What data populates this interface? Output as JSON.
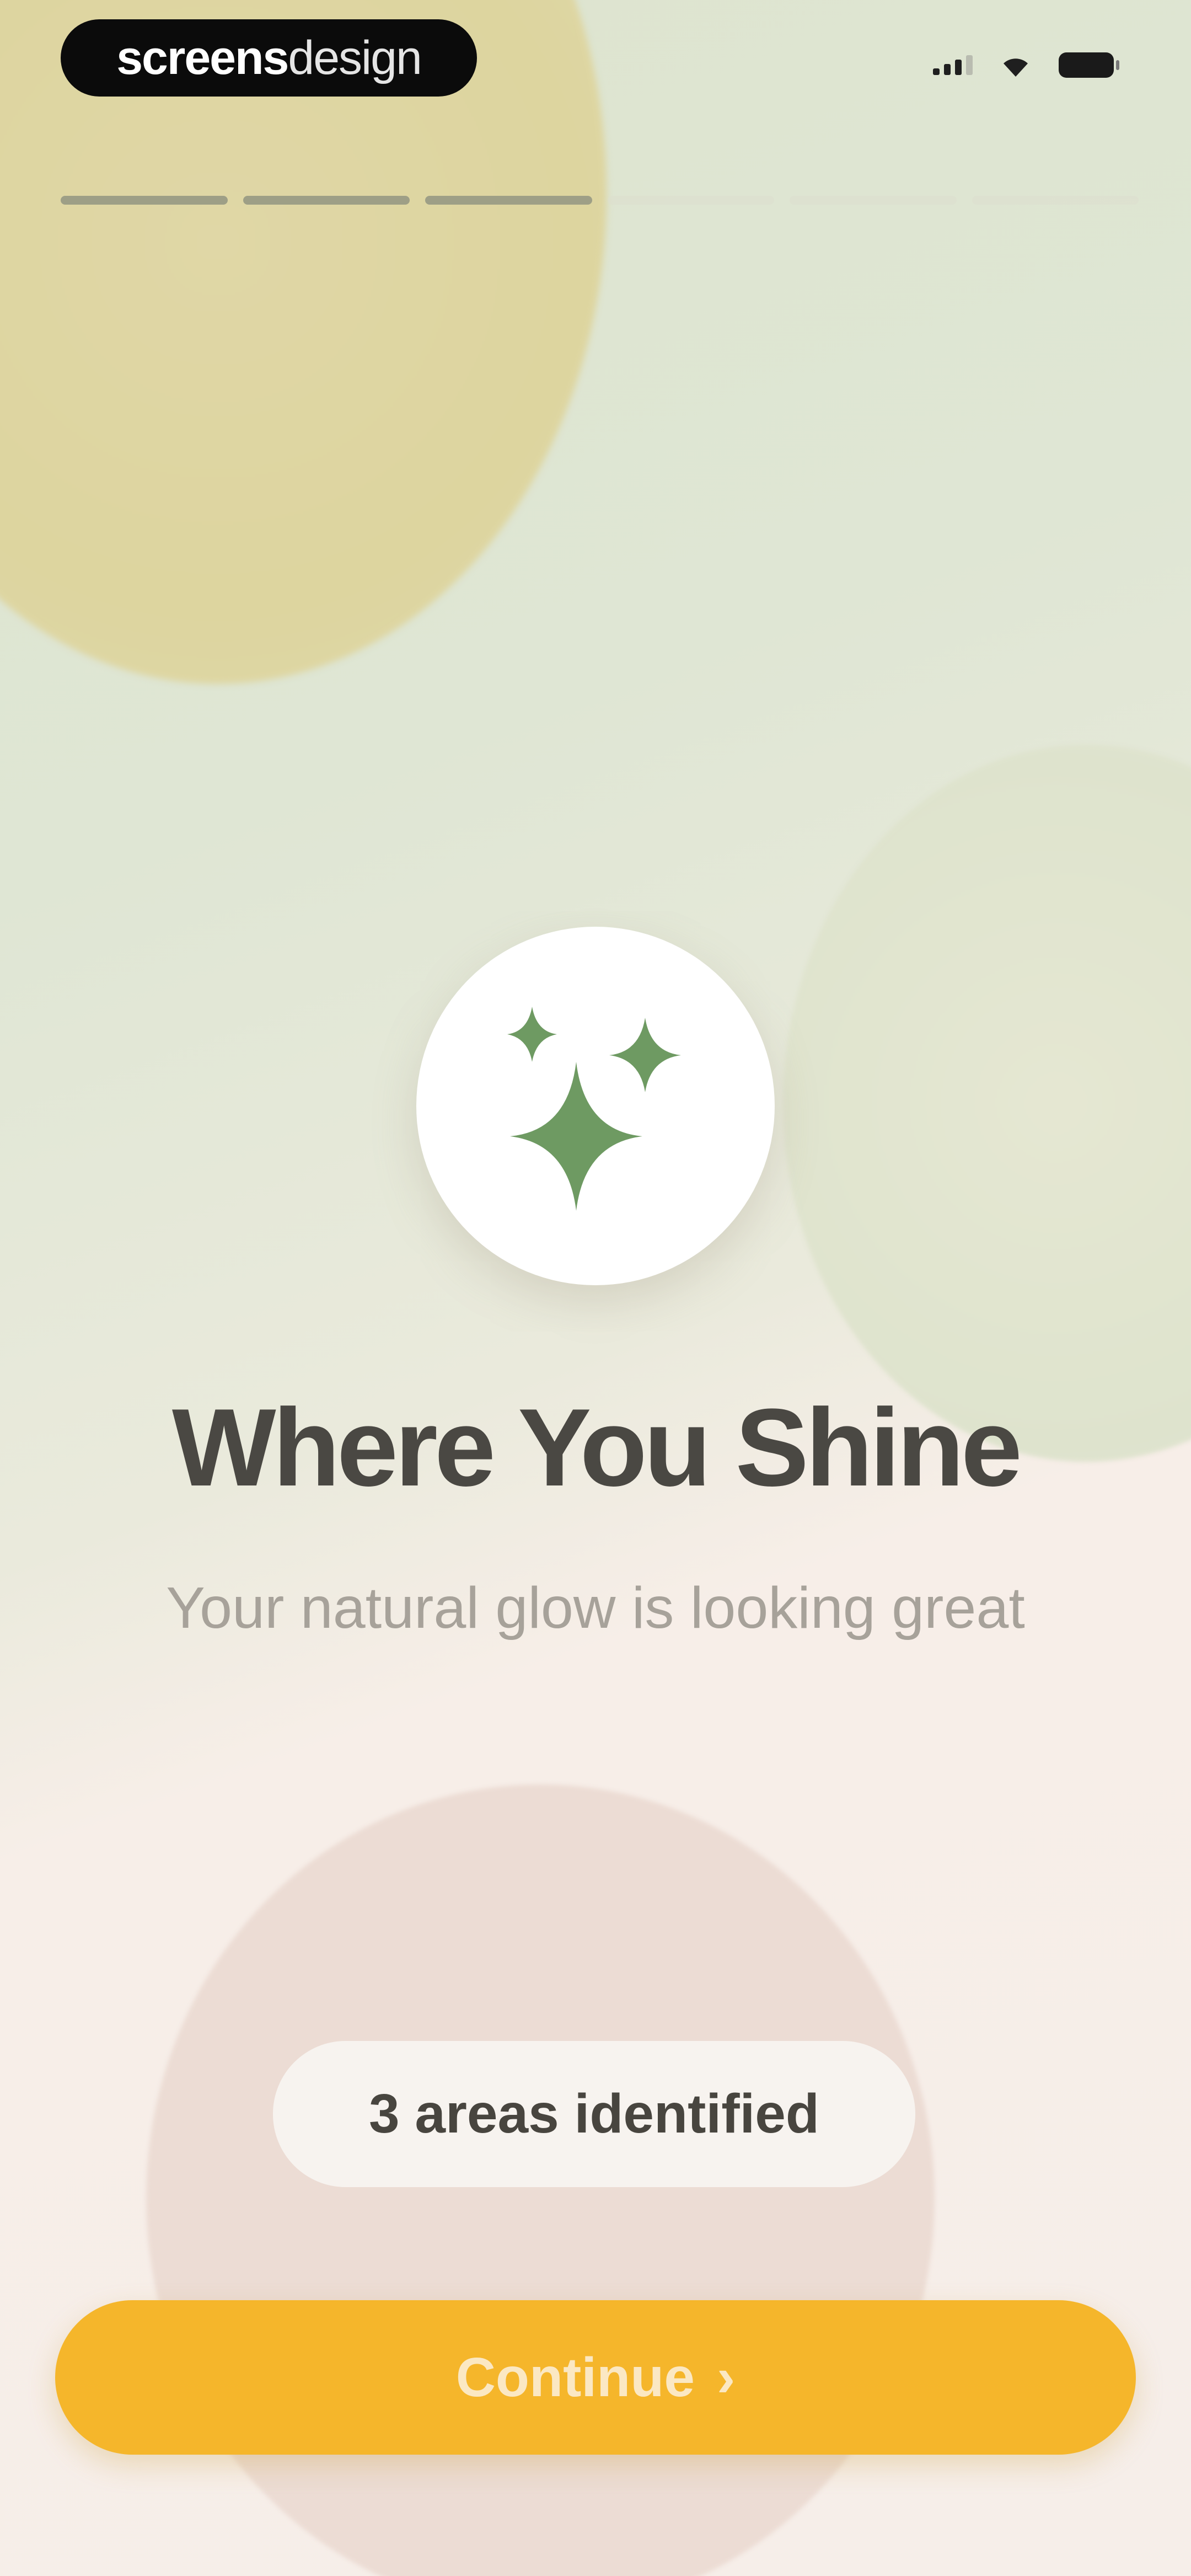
{
  "brand": {
    "strong": "screens",
    "light": "design"
  },
  "progress": {
    "total_steps": 6,
    "completed_steps": 3
  },
  "hero": {
    "icon": "sparkles-icon",
    "title": "Where You Shine",
    "subtitle": "Your natural glow is looking great"
  },
  "badge": {
    "label": "3 areas identified"
  },
  "cta": {
    "label": "Continue",
    "icon": "chevron-right-icon"
  },
  "colors": {
    "accent": "#f5b62b",
    "icon_green": "#6e9a62",
    "title_text": "#4a4843"
  }
}
